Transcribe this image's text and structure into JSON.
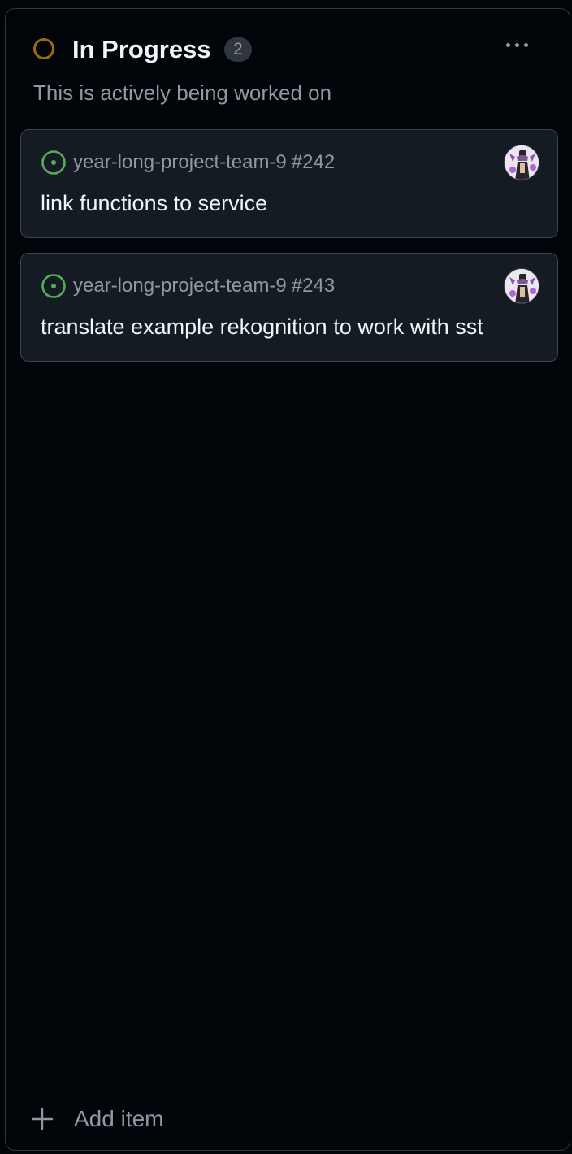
{
  "column": {
    "title": "In Progress",
    "count": "2",
    "description": "This is actively being worked on",
    "status_color": "#9e6a03",
    "more_icon": "kebab-horizontal-icon"
  },
  "cards": [
    {
      "repo": "year-long-project-team-9",
      "number": "#242",
      "title": "link functions to service",
      "status_icon": "issue-open-icon",
      "status_color": "#57ab5a"
    },
    {
      "repo": "year-long-project-team-9",
      "number": "#243",
      "title": "translate example rekognition to work with sst",
      "status_icon": "issue-open-icon",
      "status_color": "#57ab5a"
    }
  ],
  "footer": {
    "add_label": "Add item",
    "add_icon": "plus-icon"
  }
}
